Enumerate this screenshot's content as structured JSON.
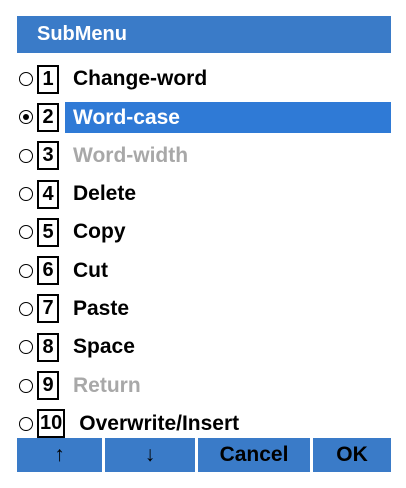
{
  "header": {
    "title": "SubMenu"
  },
  "menu": {
    "items": [
      {
        "num": "1",
        "label": "Change-word",
        "state": "normal",
        "checked": false
      },
      {
        "num": "2",
        "label": "Word-case",
        "state": "selected",
        "checked": true
      },
      {
        "num": "3",
        "label": "Word-width",
        "state": "disabled",
        "checked": false
      },
      {
        "num": "4",
        "label": "Delete",
        "state": "normal",
        "checked": false
      },
      {
        "num": "5",
        "label": "Copy",
        "state": "normal",
        "checked": false
      },
      {
        "num": "6",
        "label": "Cut",
        "state": "normal",
        "checked": false
      },
      {
        "num": "7",
        "label": "Paste",
        "state": "normal",
        "checked": false
      },
      {
        "num": "8",
        "label": "Space",
        "state": "normal",
        "checked": false
      },
      {
        "num": "9",
        "label": "Return",
        "state": "disabled",
        "checked": false
      },
      {
        "num": "10",
        "label": "Overwrite/Insert",
        "state": "normal",
        "checked": false
      }
    ]
  },
  "softkeys": {
    "up": "↑",
    "down": "↓",
    "cancel": "Cancel",
    "ok": "OK"
  },
  "colors": {
    "header_bg": "#3a7bc8",
    "selection_bg": "#2f7ad6",
    "disabled_text": "#a8a8a8"
  }
}
